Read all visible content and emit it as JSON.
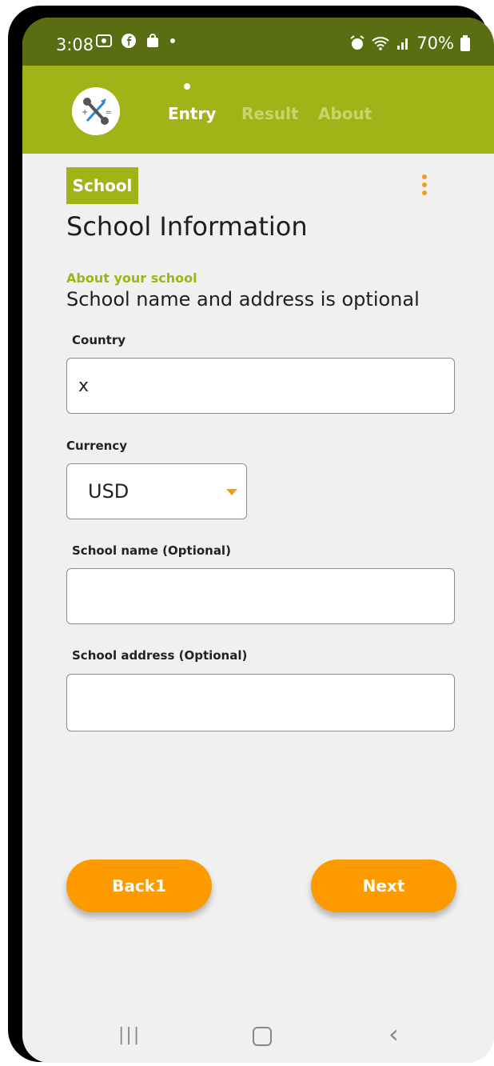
{
  "status_bar": {
    "time": "3:08",
    "battery": "70%",
    "icons": [
      "screenshot-icon",
      "facebook-icon",
      "shopping-bag-icon",
      "dot-icon",
      "alarm-icon",
      "wifi-icon",
      "signal-icon",
      "battery-icon"
    ]
  },
  "header": {
    "tabs": [
      {
        "label": "Entry",
        "active": true
      },
      {
        "label": "Result",
        "active": false
      },
      {
        "label": "About",
        "active": false
      }
    ],
    "colors": {
      "bar": "#a1b417",
      "status": "#5a6d12",
      "inactive_tab": "#c9d56a"
    }
  },
  "content": {
    "badge": "School",
    "title": "School Information",
    "subhead": "About your school",
    "description": "School name and address is optional",
    "fields": {
      "country_label": "Country",
      "country_value": "x",
      "currency_label": "Currency",
      "currency_value": "USD",
      "school_name_label": "School name (Optional)",
      "school_name_value": "",
      "school_address_label": "School address (Optional)",
      "school_address_value": ""
    }
  },
  "actions": {
    "back_label": "Back1",
    "next_label": "Next",
    "button_color": "#fd9a00"
  }
}
